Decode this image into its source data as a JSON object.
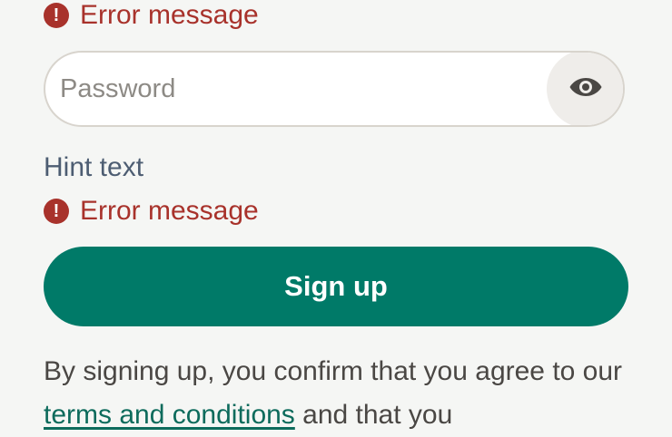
{
  "form": {
    "error_top": {
      "icon": "error-icon",
      "icon_glyph": "!",
      "text": "Error message"
    },
    "password": {
      "placeholder": "Password",
      "toggle_icon": "eye-icon"
    },
    "hint": "Hint text",
    "error_bottom": {
      "icon": "error-icon",
      "icon_glyph": "!",
      "text": "Error message"
    },
    "submit_label": "Sign up",
    "legal": {
      "before_link": "By signing up, you confirm that you agree to our ",
      "link_text": "terms and conditions",
      "after_link": " and that you"
    }
  },
  "colors": {
    "background": "#f5f6f4",
    "error": "#a8322b",
    "primary": "#007a68",
    "link": "#0d6b5c",
    "hint": "#4d5d72"
  }
}
